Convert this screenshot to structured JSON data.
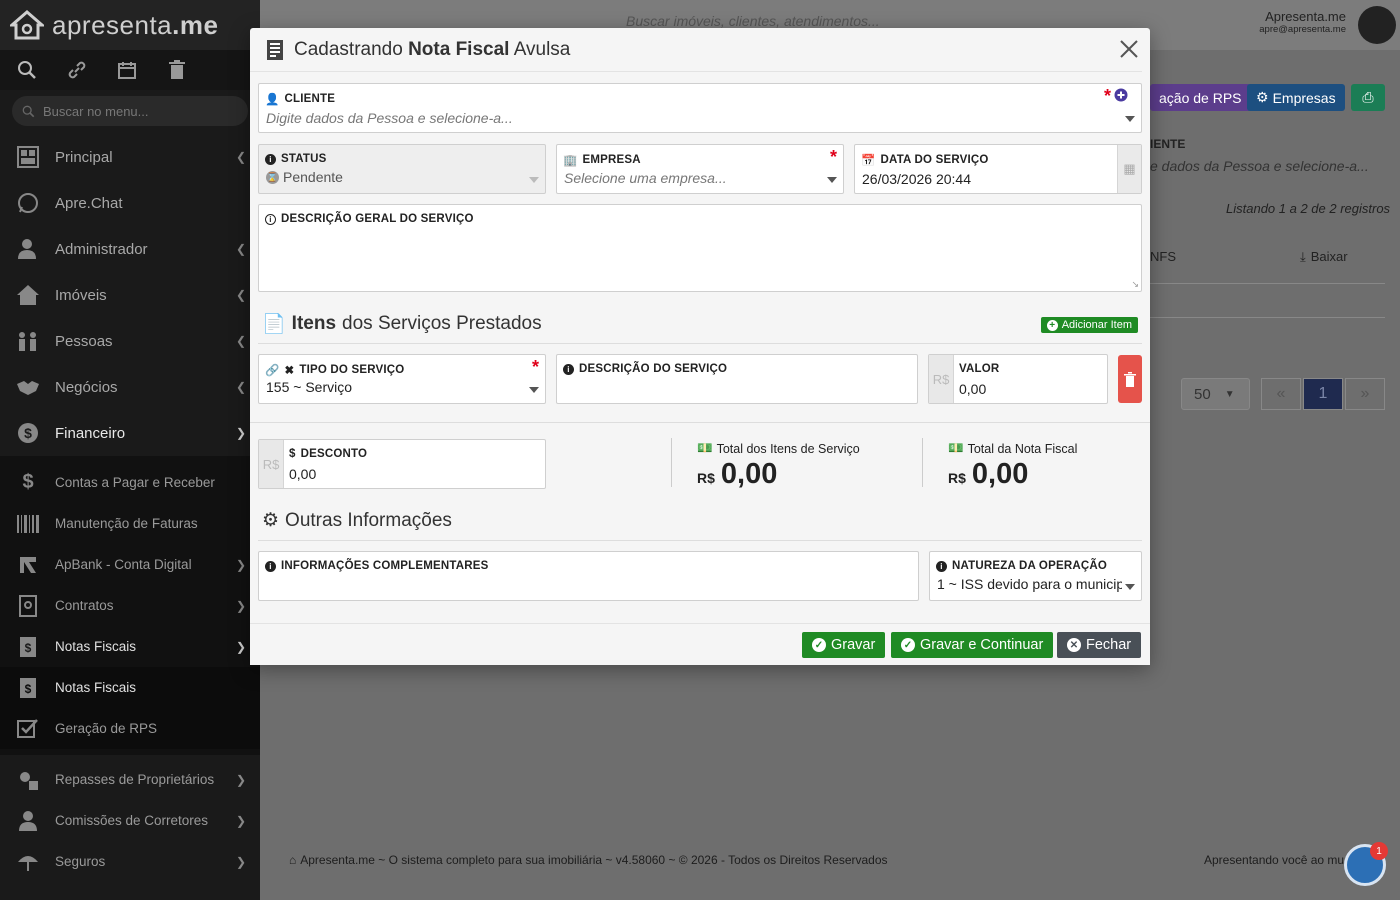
{
  "app": {
    "logo_text_a": "apresenta",
    "logo_text_b": ".me"
  },
  "sidebar": {
    "search_placeholder": "Buscar no menu...",
    "items": [
      {
        "label": "Principal"
      },
      {
        "label": "Apre.Chat"
      },
      {
        "label": "Administrador"
      },
      {
        "label": "Imóveis"
      },
      {
        "label": "Pessoas"
      },
      {
        "label": "Negócios"
      },
      {
        "label": "Financeiro"
      }
    ],
    "financeiro_sub": [
      {
        "label": "Contas a Pagar e Receber"
      },
      {
        "label": "Manutenção de Faturas"
      },
      {
        "label": "ApBank - Conta Digital"
      },
      {
        "label": "Contratos"
      },
      {
        "label": "Notas Fiscais"
      }
    ],
    "notas_sub": [
      {
        "label": "Notas Fiscais"
      },
      {
        "label": "Geração de RPS"
      }
    ],
    "bottom_items": [
      {
        "label": "Repasses de Proprietários"
      },
      {
        "label": "Comissões de Corretores"
      },
      {
        "label": "Seguros"
      }
    ]
  },
  "header": {
    "search_placeholder": "Buscar imóveis, clientes, atendimentos...",
    "user_name": "Apresenta.me",
    "user_email": "apre@apresenta.me",
    "badge": "1"
  },
  "background": {
    "btn_rps": "ação de RPS",
    "btn_empresas": "Empresas",
    "cliente_label": "IENTE",
    "cliente_placeholder": "e dados da Pessoa e selecione-a...",
    "listing": "Listando 1 a 2 de 2 registros",
    "col_nfs": "NFS",
    "col_baixar": "Baixar",
    "page_size": "50",
    "page_current": "1",
    "footer": "Apresenta.me ~ O sistema completo para sua imobiliária ~ v4.58060 ~ © 2026 - Todos os Direitos Reservados",
    "footer_right": "Apresentando você ao mun",
    "fab_badge": "1"
  },
  "modal": {
    "title_pre": "Cadastrando",
    "title_bold": "Nota Fiscal",
    "title_post": "Avulsa",
    "cliente": {
      "label": "CLIENTE",
      "placeholder": "Digite dados da Pessoa e selecione-a..."
    },
    "status": {
      "label": "STATUS",
      "value": "Pendente"
    },
    "empresa": {
      "label": "EMPRESA",
      "placeholder": "Selecione uma empresa..."
    },
    "data_servico": {
      "label": "DATA DO SERVIÇO",
      "value": "26/03/2026 20:44"
    },
    "descricao_geral": {
      "label": "DESCRIÇÃO GERAL DO SERVIÇO",
      "value": ""
    },
    "itens_title_bold": "Itens",
    "itens_title_rest": "dos Serviços Prestados",
    "add_item": "Adicionar Item",
    "tipo_servico": {
      "label": "TIPO DO SERVIÇO",
      "value": "155 ~ Serviço"
    },
    "descricao_servico": {
      "label": "DESCRIÇÃO DO SERVIÇO",
      "value": ""
    },
    "valor": {
      "label": "VALOR",
      "prefix": "R$",
      "value": "0,00"
    },
    "desconto": {
      "label": "DESCONTO",
      "prefix": "R$",
      "value": "0,00"
    },
    "total_itens": {
      "label": "Total dos Itens de Serviço",
      "currency": "R$",
      "value": "0,00"
    },
    "total_nota": {
      "label": "Total da Nota Fiscal",
      "currency": "R$",
      "value": "0,00"
    },
    "outras_title": "Outras Informações",
    "info_complementares": {
      "label": "INFORMAÇÕES COMPLEMENTARES",
      "value": ""
    },
    "natureza": {
      "label": "NATUREZA DA OPERAÇÃO",
      "value": "1 ~ ISS devido para o municip"
    },
    "buttons": {
      "gravar": "Gravar",
      "gravar_continuar": "Gravar e Continuar",
      "fechar": "Fechar"
    }
  },
  "colors": {
    "green": "#1f8b24",
    "danger": "#e5534b",
    "required": "#e0001a",
    "dark_btn": "#495057",
    "purple": "#6f42c1",
    "blue": "#1d5fa0",
    "teal": "#1f9d6b"
  }
}
